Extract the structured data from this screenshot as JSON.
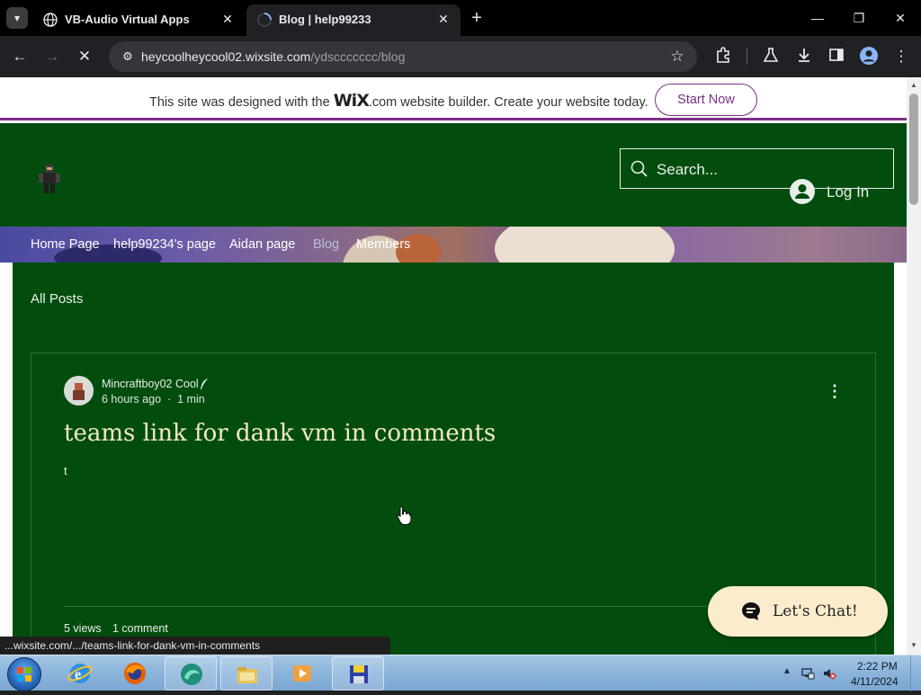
{
  "browser": {
    "tabs": [
      {
        "title": "VB-Audio Virtual Apps",
        "active": false
      },
      {
        "title": "Blog | help99233",
        "active": true
      }
    ],
    "url": {
      "domain": "heycoolheycool02.wixsite.com",
      "path": "/ydsccccccc/blog"
    },
    "status_url": "...wixsite.com/.../teams-link-for-dank-vm-in-comments"
  },
  "wix_banner": {
    "text_before": "This site was designed with the ",
    "logo_text": "WiX",
    "text_after": ".com website builder. Create your website today.",
    "cta": "Start Now"
  },
  "site": {
    "search_placeholder": "Search...",
    "login_label": "Log In",
    "nav": [
      {
        "label": "Home Page",
        "active": false
      },
      {
        "label": "help99234's page",
        "active": false
      },
      {
        "label": "Aidan page",
        "active": false
      },
      {
        "label": "Blog",
        "active": true
      },
      {
        "label": "Members",
        "active": false
      }
    ],
    "all_posts_label": "All Posts",
    "post": {
      "author": "Mincraftboy02 Cool",
      "time_ago": "6 hours ago",
      "separator": "·",
      "read_time": "1 min",
      "title": "teams link for dank vm in comments",
      "excerpt": "t",
      "views": "5 views",
      "comments": "1 comment"
    },
    "chat_label": "Let's Chat!"
  },
  "taskbar": {
    "apps": [
      "internet-explorer",
      "firefox",
      "browser-app",
      "file-explorer",
      "media-player",
      "floppy-app"
    ],
    "clock_time": "2:22 PM",
    "clock_date": "4/11/2024"
  },
  "colors": {
    "site_background": "#024d0e",
    "wix_accent": "#7b2f86",
    "post_title": "#f4e9c0",
    "chat_button": "#fbeccd"
  }
}
